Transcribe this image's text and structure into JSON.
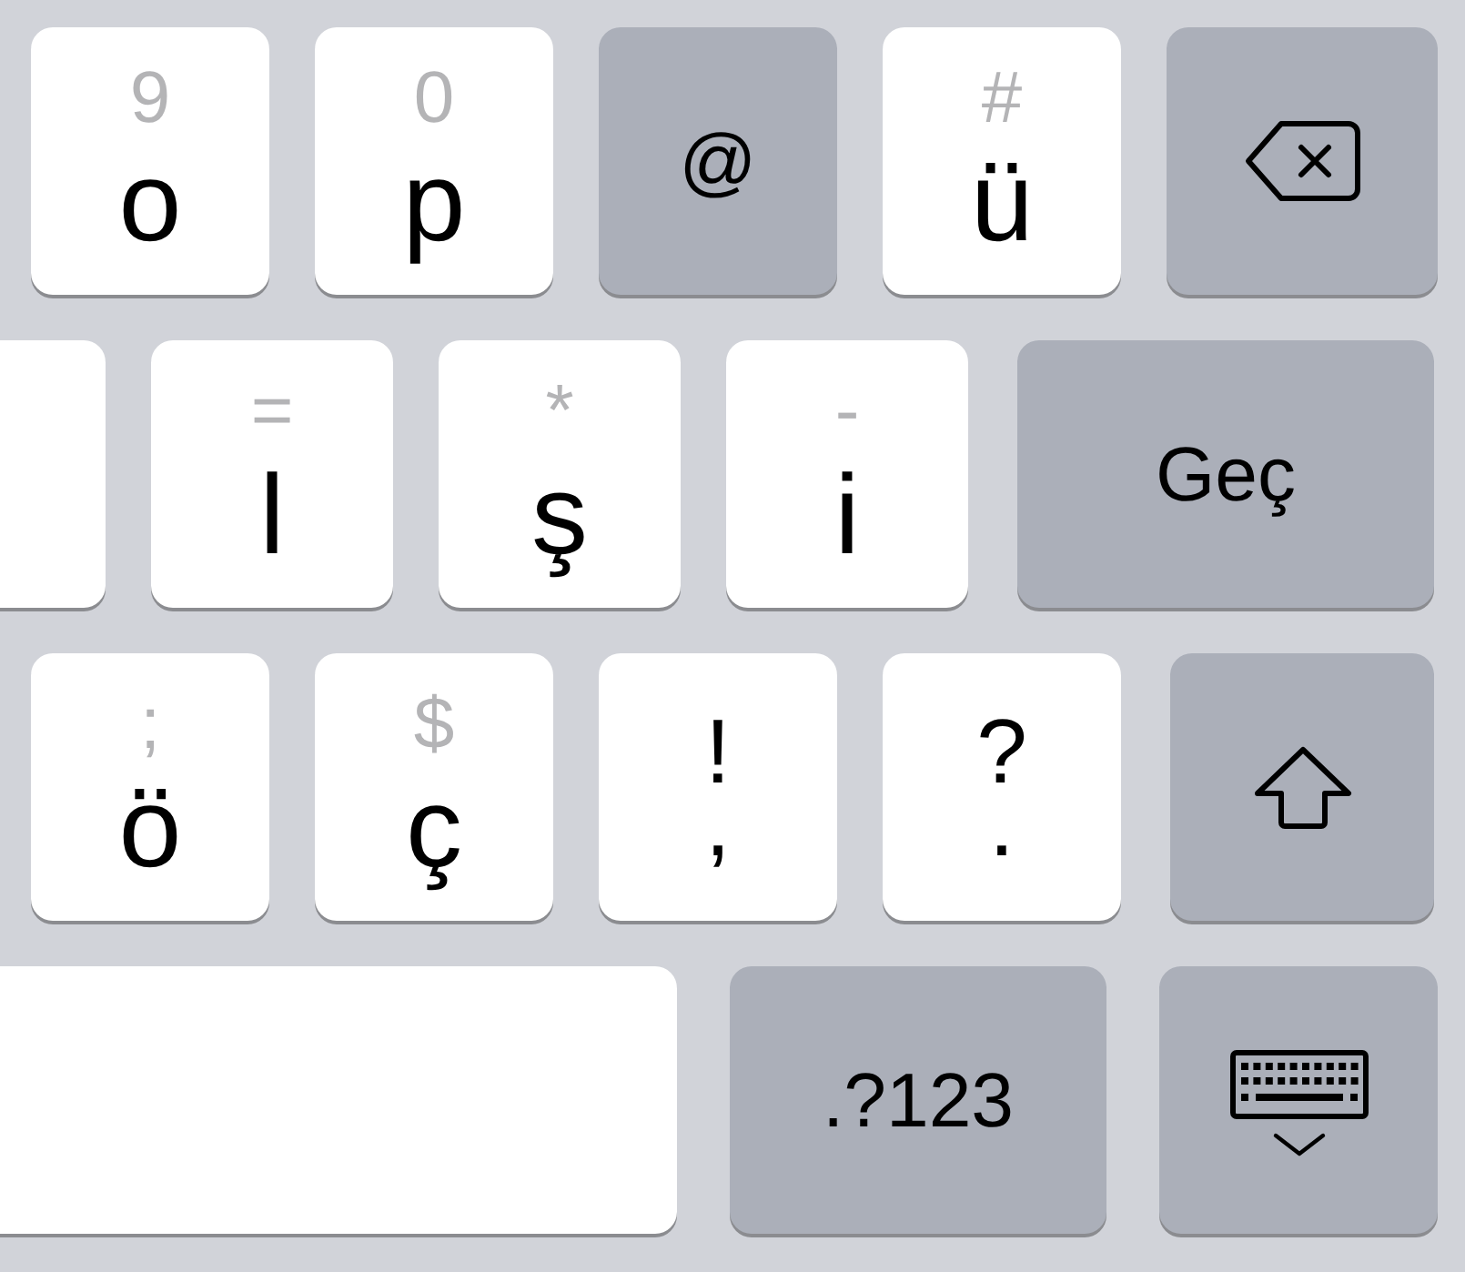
{
  "keyboard": {
    "rows": [
      {
        "keys": [
          {
            "kind": "letter",
            "hint": "9",
            "label": "o"
          },
          {
            "kind": "letter",
            "hint": "0",
            "label": "p"
          },
          {
            "kind": "function",
            "label": "@"
          },
          {
            "kind": "letter",
            "hint": "#",
            "label": "ü"
          },
          {
            "kind": "backspace"
          }
        ]
      },
      {
        "keys": [
          {
            "kind": "partial"
          },
          {
            "kind": "letter",
            "hint": "=",
            "label": "l"
          },
          {
            "kind": "letter",
            "hint": "*",
            "label": "ş"
          },
          {
            "kind": "letter",
            "hint": "-",
            "label": "i"
          },
          {
            "kind": "function",
            "label": "Geç"
          }
        ]
      },
      {
        "keys": [
          {
            "kind": "letter",
            "hint": ";",
            "label": "ö"
          },
          {
            "kind": "letter",
            "hint": "$",
            "label": "ç"
          },
          {
            "kind": "symbol",
            "upper": "!",
            "lower": ","
          },
          {
            "kind": "symbol",
            "upper": "?",
            "lower": "."
          },
          {
            "kind": "shift"
          }
        ]
      },
      {
        "keys": [
          {
            "kind": "space"
          },
          {
            "kind": "function",
            "label": ".?123"
          },
          {
            "kind": "dismiss"
          }
        ]
      }
    ]
  }
}
